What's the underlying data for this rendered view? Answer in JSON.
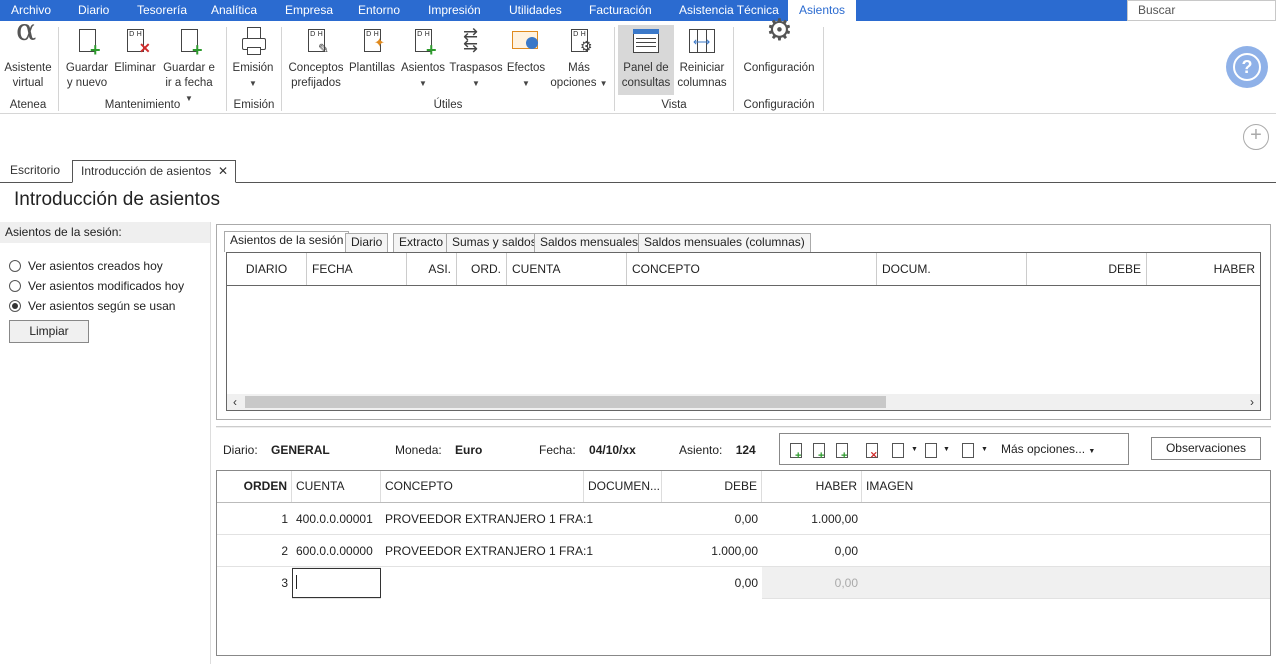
{
  "menu": {
    "items": [
      "Archivo",
      "Diario",
      "Tesorería",
      "Analítica",
      "Empresa",
      "Entorno",
      "Impresión",
      "Utilidades",
      "Facturación",
      "Asistencia Técnica",
      "Asientos"
    ],
    "search_placeholder": "Buscar"
  },
  "ribbon": {
    "assistant": [
      "Asistente",
      "virtual"
    ],
    "save_new": [
      "Guardar",
      "y nuevo"
    ],
    "delete": "Eliminar",
    "save_date": [
      "Guardar e",
      "ir a fecha"
    ],
    "emission": "Emisión",
    "concepts": [
      "Conceptos",
      "prefijados"
    ],
    "templates": "Plantillas",
    "entries": "Asientos",
    "transfers": "Traspasos",
    "effects": "Efectos",
    "more": [
      "Más",
      "opciones"
    ],
    "panel": [
      "Panel de",
      "consultas"
    ],
    "reset": [
      "Reiniciar",
      "columnas"
    ],
    "config": "Configuración",
    "groups": [
      "Atenea",
      "Mantenimiento",
      "Emisión",
      "Útiles",
      "Vista",
      "Configuración"
    ]
  },
  "tabs": [
    "Escritorio",
    "Introducción de asientos"
  ],
  "page_title": "Introducción de asientos",
  "left": {
    "header": "Asientos de la sesión:",
    "options": [
      "Ver asientos creados hoy",
      "Ver asientos modificados hoy",
      "Ver asientos según se usan"
    ],
    "selected": 2,
    "clear": "Limpiar"
  },
  "inner_tabs": [
    "Asientos de la sesión",
    "Diario",
    "Extracto",
    "Sumas y saldos",
    "Saldos mensuales",
    "Saldos mensuales (columnas)"
  ],
  "grid1_cols": [
    "DIARIO",
    "FECHA",
    "ASI.",
    "ORD.",
    "CUENTA",
    "CONCEPTO",
    "DOCUM.",
    "DEBE",
    "HABER"
  ],
  "info": {
    "diario_label": "Diario:",
    "diario": "GENERAL",
    "moneda_label": "Moneda:",
    "moneda": "Euro",
    "fecha_label": "Fecha:",
    "fecha": "04/10/xx",
    "asiento_label": "Asiento:",
    "asiento": "124",
    "more": "Más opciones...",
    "obs": "Observaciones"
  },
  "grid2_cols": [
    "ORDEN",
    "CUENTA",
    "CONCEPTO",
    "DOCUMEN...",
    "DEBE",
    "HABER",
    "IMAGEN"
  ],
  "rows": [
    {
      "orden": "1",
      "cuenta": "400.0.0.00001",
      "concepto": "PROVEEDOR EXTRANJERO 1 FRA:1",
      "debe": "0,00",
      "haber": "1.000,00"
    },
    {
      "orden": "2",
      "cuenta": "600.0.0.00000",
      "concepto": "PROVEEDOR EXTRANJERO 1 FRA:1",
      "debe": "1.000,00",
      "haber": "0,00"
    },
    {
      "orden": "3",
      "cuenta": "",
      "concepto": "",
      "debe": "0,00",
      "haber": "0,00"
    }
  ],
  "colors": {
    "menu_bar": "#2b6bd0",
    "help": "#8fb1e8"
  }
}
